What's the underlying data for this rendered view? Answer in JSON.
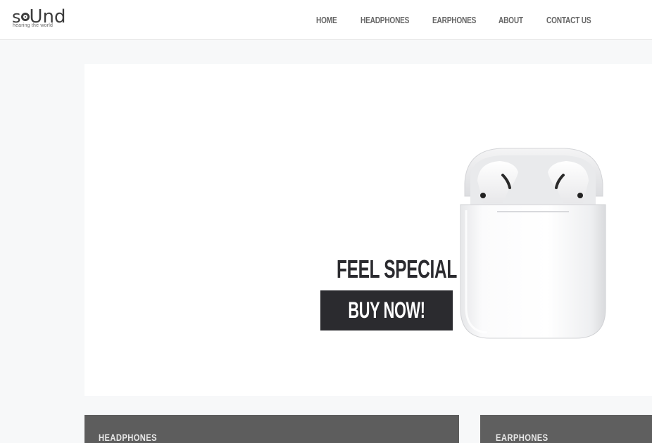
{
  "brand": {
    "name_part1": "s",
    "name_part2": "Und",
    "tagline": "hearing the world"
  },
  "nav": {
    "items": [
      {
        "label": "HOME"
      },
      {
        "label": "HEADPHONES"
      },
      {
        "label": "EARPHONES"
      },
      {
        "label": "ABOUT"
      },
      {
        "label": "CONTACT US"
      }
    ]
  },
  "hero": {
    "title": "FEEL SPECIAL",
    "cta_label": "BUY NOW!",
    "product_icon": "airpods-case-image"
  },
  "categories": [
    {
      "label": "HEADPHONES"
    },
    {
      "label": "EARPHONES"
    }
  ],
  "colors": {
    "page_bg": "#f7f8f9",
    "dark": "#2b2b2f",
    "nav_text": "#666666"
  }
}
